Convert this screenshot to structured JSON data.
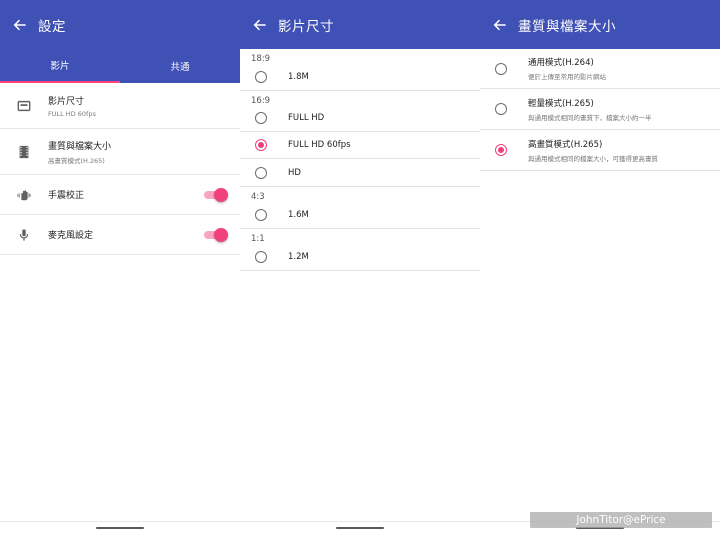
{
  "screen1": {
    "title": "設定",
    "tabs": [
      {
        "label": "影片",
        "active": true
      },
      {
        "label": "共通",
        "active": false
      }
    ],
    "items": [
      {
        "icon": "aspect-ratio-icon",
        "title": "影片尺寸",
        "subtitle": "FULL HD 60fps"
      },
      {
        "icon": "film-strip-icon",
        "title": "畫質與檔案大小",
        "subtitle": "高畫質模式(H.265)"
      },
      {
        "icon": "shaky-hand-icon",
        "title": "手震校正",
        "toggle_on": true
      },
      {
        "icon": "microphone-icon",
        "title": "麥克風設定",
        "toggle_on": true
      }
    ]
  },
  "screen2": {
    "title": "影片尺寸",
    "groups": [
      {
        "label": "18:9",
        "options": [
          {
            "label": "1.8M",
            "selected": false
          }
        ]
      },
      {
        "label": "16:9",
        "options": [
          {
            "label": "FULL HD",
            "selected": false
          },
          {
            "label": "FULL HD 60fps",
            "selected": true
          },
          {
            "label": "HD",
            "selected": false
          }
        ]
      },
      {
        "label": "4:3",
        "options": [
          {
            "label": "1.6M",
            "selected": false
          }
        ]
      },
      {
        "label": "1:1",
        "options": [
          {
            "label": "1.2M",
            "selected": false
          }
        ]
      }
    ]
  },
  "screen3": {
    "title": "畫質與檔案大小",
    "options": [
      {
        "title": "通用模式(H.264)",
        "subtitle": "便於上傳至常用的影片網站",
        "selected": false
      },
      {
        "title": "輕量模式(H.265)",
        "subtitle": "與通用模式相同的畫質下，檔案大小約一半",
        "selected": false
      },
      {
        "title": "高畫質模式(H.265)",
        "subtitle": "與通用模式相同的檔案大小，可獲得更高畫質",
        "selected": true
      }
    ]
  },
  "watermark": "JohnTitor@ePrice",
  "colors": {
    "appbar": "#3f51b5",
    "accent": "#f0417a"
  }
}
